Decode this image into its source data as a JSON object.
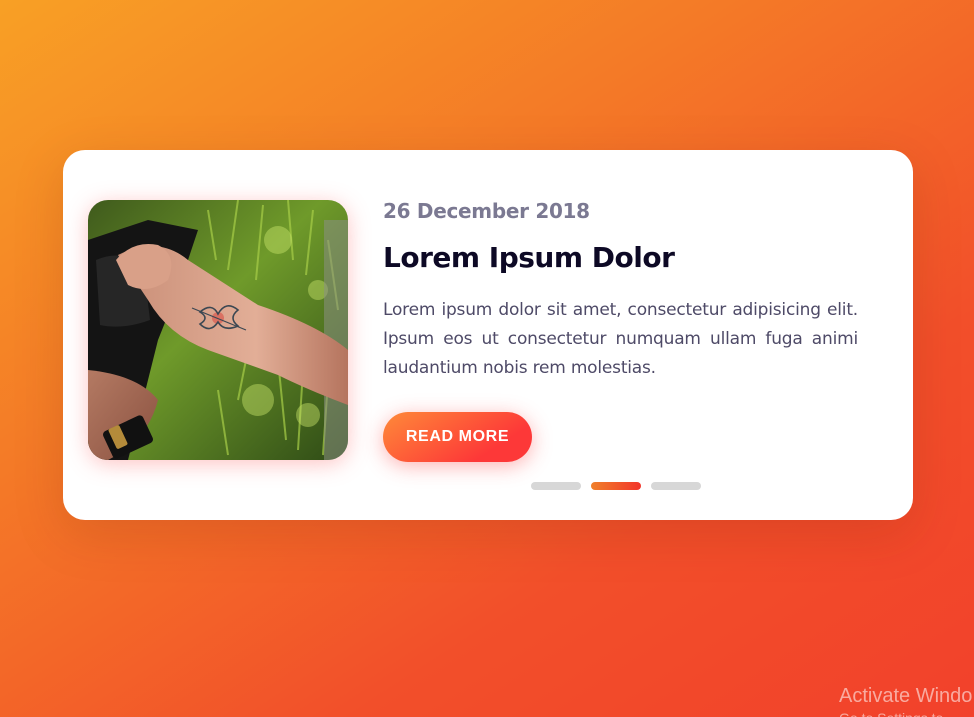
{
  "post": {
    "date": "26 December 2018",
    "title": "Lorem Ipsum Dolor",
    "text": "Lorem ipsum dolor sit amet, consectetur adipisicing elit. Ipsum eos ut consectetur numquam ullam fuga animi laudantium nobis rem molestias.",
    "button_label": "READ MORE"
  },
  "slider": {
    "dots": [
      {
        "active": false
      },
      {
        "active": true
      },
      {
        "active": false
      }
    ],
    "active_index": 1
  },
  "watermark": {
    "line1": "Activate Windo",
    "line2": "Go to Settings to"
  },
  "colors": {
    "background_start": "#f8a025",
    "background_end": "#f2412b",
    "button_start": "#fe8a39",
    "button_end": "#fd3838",
    "title": "#0d0925",
    "date": "#7b7992",
    "text": "#4e4a67",
    "dot_inactive": "#d7d7d7"
  }
}
